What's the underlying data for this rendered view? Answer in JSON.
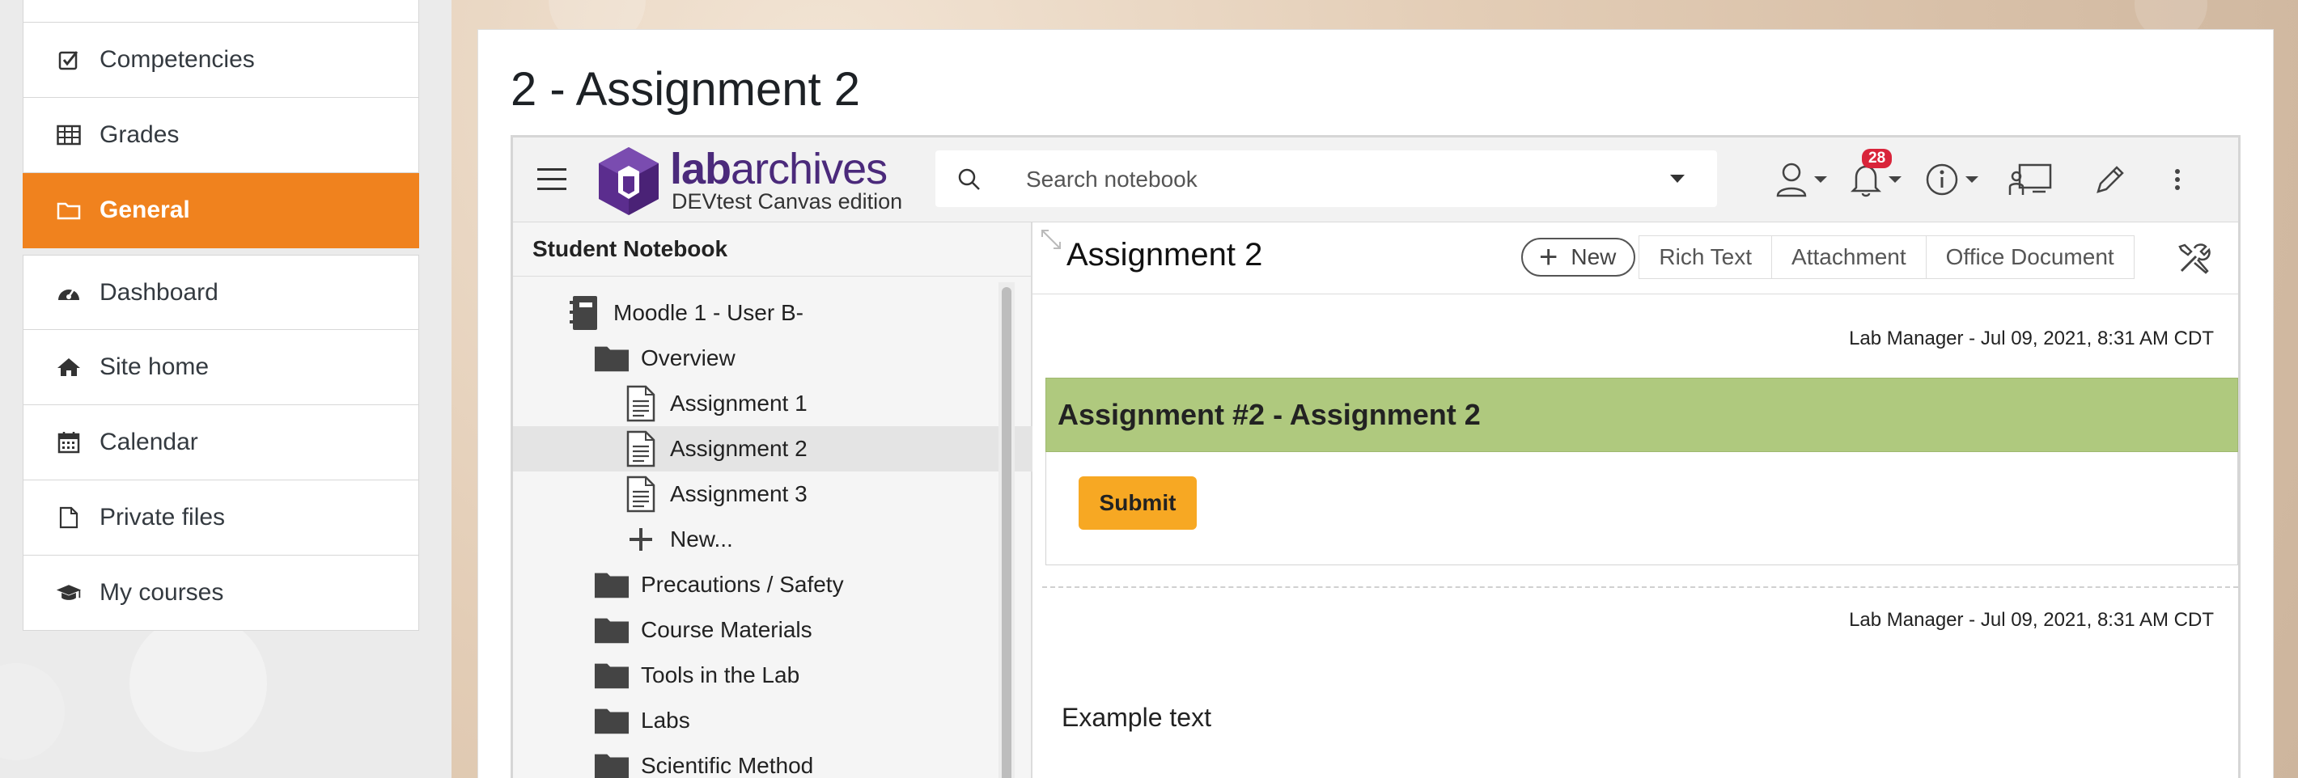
{
  "sidebar": {
    "items": [
      {
        "label": "Competencies",
        "icon": "check-square-icon"
      },
      {
        "label": "Grades",
        "icon": "table-icon"
      },
      {
        "label": "General",
        "icon": "folder-icon",
        "active": true
      },
      {
        "label": "Dashboard",
        "icon": "dashboard-icon"
      },
      {
        "label": "Site home",
        "icon": "home-icon"
      },
      {
        "label": "Calendar",
        "icon": "calendar-icon"
      },
      {
        "label": "Private files",
        "icon": "file-icon"
      },
      {
        "label": "My courses",
        "icon": "graduation-cap-icon"
      }
    ],
    "active_color": "#f0821e"
  },
  "page": {
    "title": "2 - Assignment 2"
  },
  "labarchives": {
    "brand_bold": "lab",
    "brand_rest": "archives",
    "edition": "DEVtest Canvas edition",
    "brand_color": "#4b2a7b",
    "search": {
      "placeholder": "Search notebook"
    },
    "notifications_count": "28",
    "tree": {
      "header": "Student Notebook",
      "items": [
        {
          "label": "Moodle 1 - User B-",
          "icon": "notebook-icon",
          "depth": 0
        },
        {
          "label": "Overview",
          "icon": "folder-icon",
          "depth": 1
        },
        {
          "label": "Assignment 1",
          "icon": "page-icon",
          "depth": 2
        },
        {
          "label": "Assignment 2",
          "icon": "page-icon",
          "depth": 2,
          "selected": true
        },
        {
          "label": "Assignment 3",
          "icon": "page-icon",
          "depth": 2
        },
        {
          "label": "New...",
          "icon": "plus-icon",
          "depth": 2
        },
        {
          "label": "Precautions / Safety",
          "icon": "folder-icon",
          "depth": 1
        },
        {
          "label": "Course Materials",
          "icon": "folder-icon",
          "depth": 1
        },
        {
          "label": "Tools in the Lab",
          "icon": "folder-icon",
          "depth": 1
        },
        {
          "label": "Labs",
          "icon": "folder-icon",
          "depth": 1
        },
        {
          "label": "Scientific Method",
          "icon": "folder-icon",
          "depth": 1
        }
      ]
    },
    "entry": {
      "title": "Assignment 2",
      "new_label": "New",
      "options": [
        "Rich Text",
        "Attachment",
        "Office Document"
      ],
      "meta_1": "Lab Manager - Jul 09, 2021, 8:31 AM CDT",
      "heading": "Assignment #2 - Assignment 2",
      "heading_color": "#afc97e",
      "submit_label": "Submit",
      "submit_color": "#f7a823",
      "meta_2": "Lab Manager - Jul 09, 2021, 8:31 AM CDT",
      "example_text": "Example text"
    }
  }
}
